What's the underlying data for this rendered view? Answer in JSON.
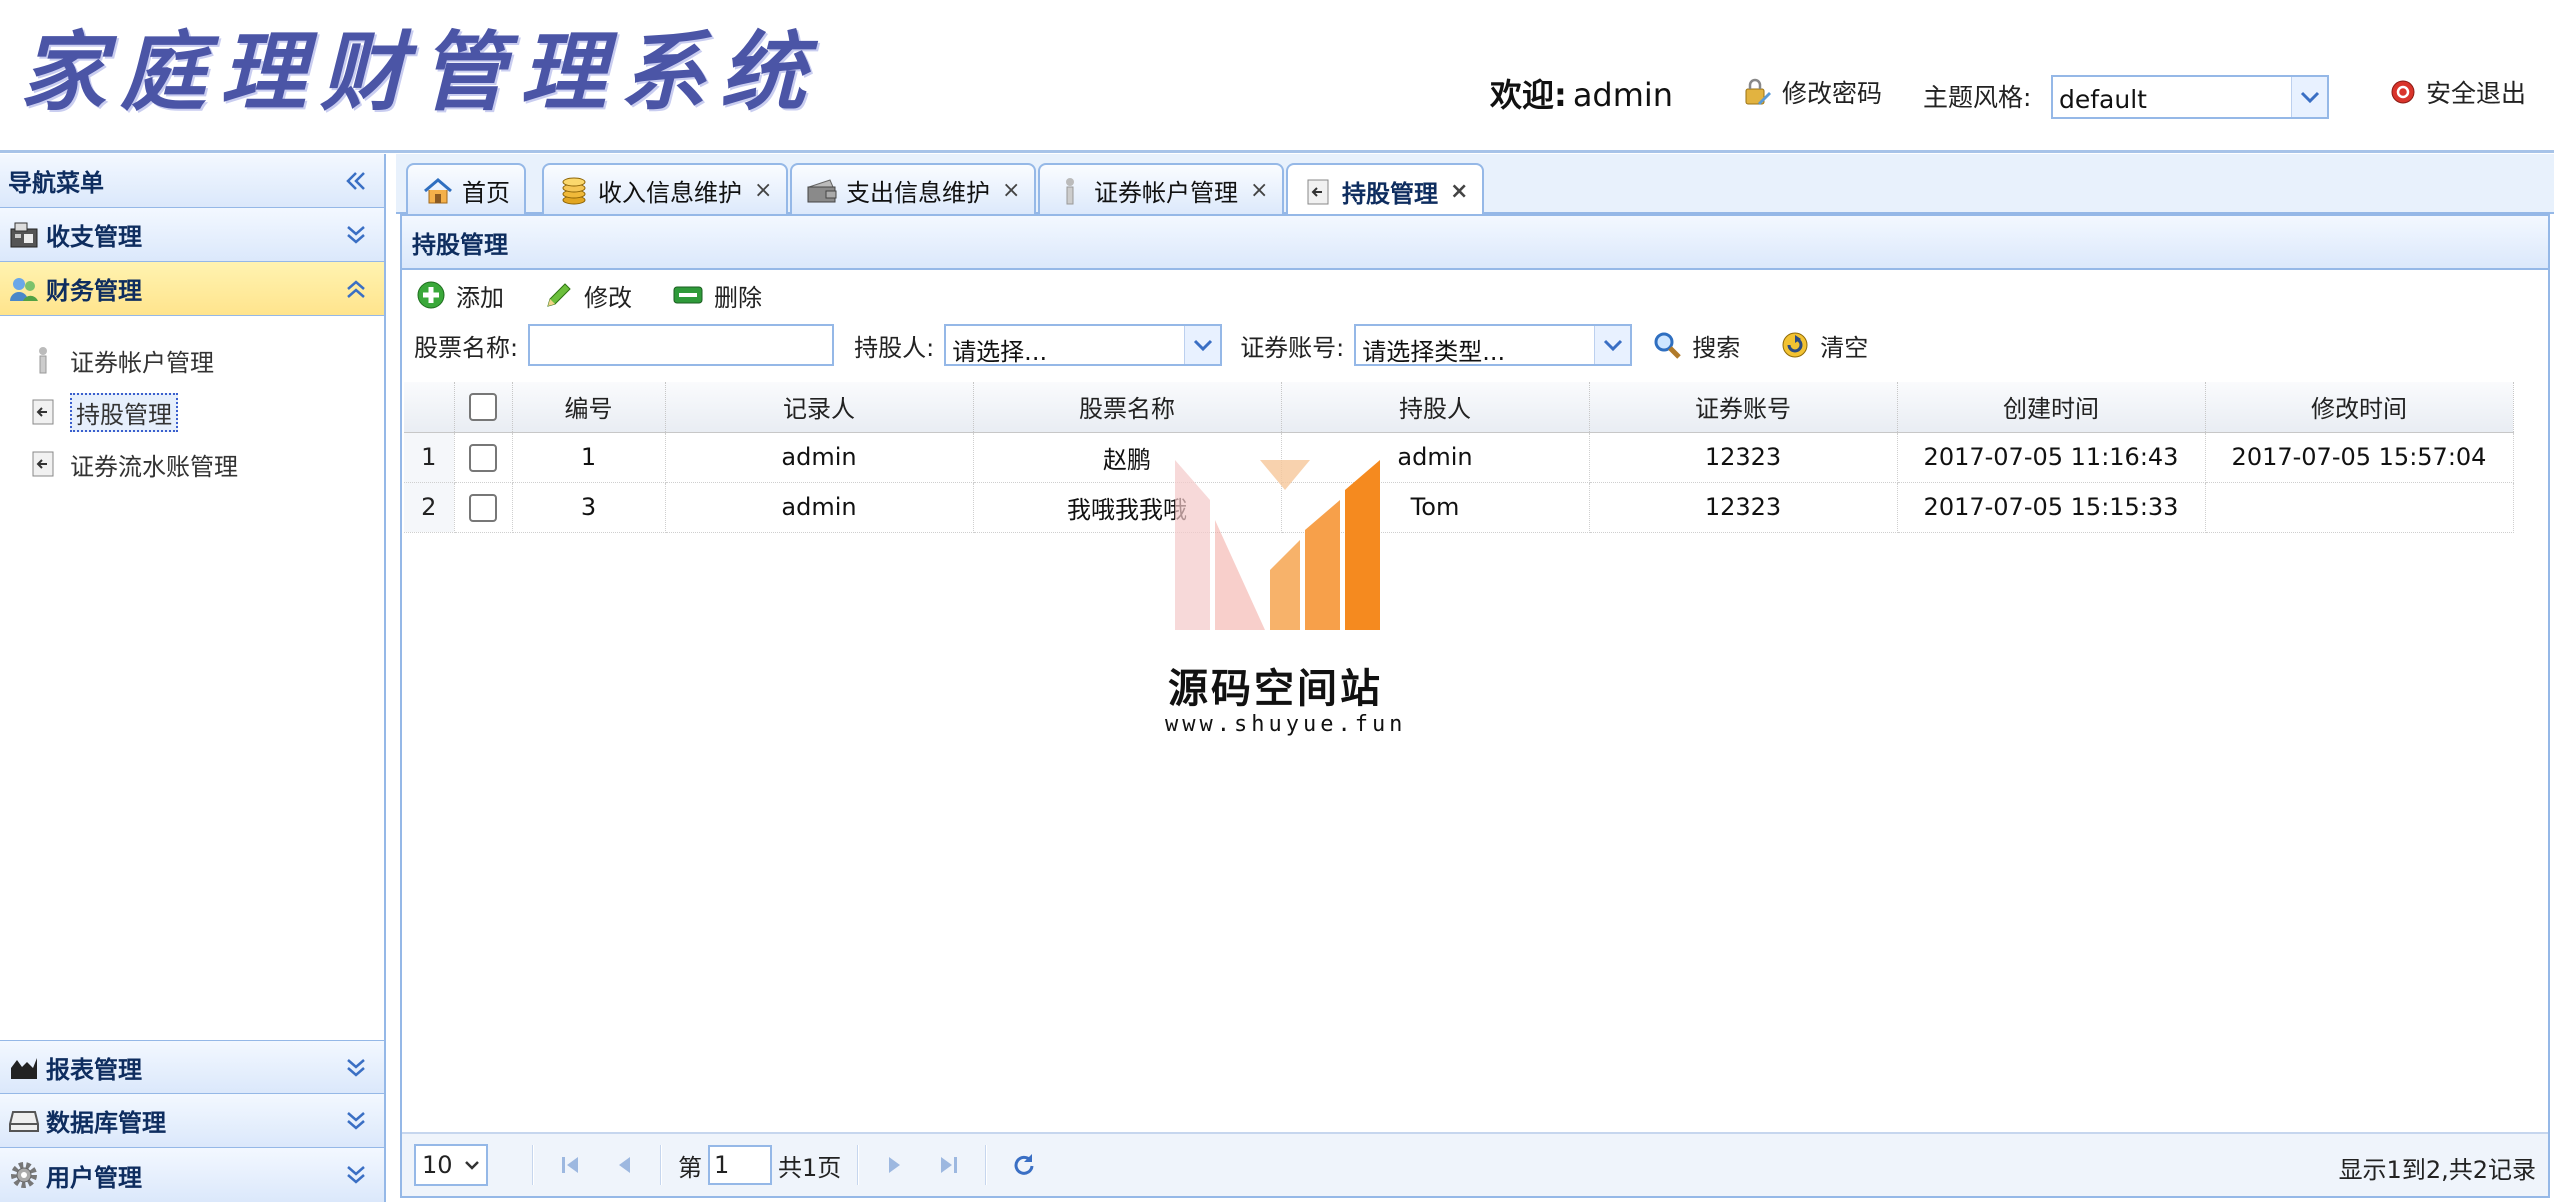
{
  "header": {
    "title": "家庭理财管理系统",
    "welcome_label": "欢迎:",
    "username": "admin",
    "change_password": "修改密码",
    "theme_label": "主题风格:",
    "theme_value": "default",
    "logout": "安全退出"
  },
  "sidebar": {
    "title": "导航菜单",
    "groups": {
      "income": "收支管理",
      "finance": "财务管理",
      "reports": "报表管理",
      "database": "数据库管理",
      "users": "用户管理"
    },
    "items": [
      "证券帐户管理",
      "持股管理",
      "证券流水账管理"
    ]
  },
  "tabs": [
    {
      "label": "首页"
    },
    {
      "label": "收入信息维护"
    },
    {
      "label": "支出信息维护"
    },
    {
      "label": "证券帐户管理"
    },
    {
      "label": "持股管理"
    }
  ],
  "content": {
    "title": "持股管理",
    "toolbar": {
      "add": "添加",
      "edit": "修改",
      "delete": "删除"
    },
    "filters": {
      "stock_name_label": "股票名称:",
      "stock_name_value": "",
      "holder_label": "持股人:",
      "holder_value": "请选择...",
      "account_label": "证券账号:",
      "account_value": "请选择类型...",
      "search": "搜索",
      "clear": "清空"
    },
    "columns": [
      "编号",
      "记录人",
      "股票名称",
      "持股人",
      "证券账号",
      "创建时间",
      "修改时间"
    ],
    "rows": [
      {
        "rn": "1",
        "id": "1",
        "recorder": "admin",
        "stock": "赵鹏",
        "holder": "admin",
        "account": "12323",
        "created": "2017-07-05 11:16:43",
        "modified": "2017-07-05 15:57:04"
      },
      {
        "rn": "2",
        "id": "3",
        "recorder": "admin",
        "stock": "我哦我我哦",
        "holder": "Tom",
        "account": "12323",
        "created": "2017-07-05 15:15:33",
        "modified": ""
      }
    ]
  },
  "pager": {
    "page_size": "10",
    "page_prefix": "第",
    "page_value": "1",
    "page_suffix": "共1页",
    "info": "显示1到2,共2记录"
  },
  "watermark": {
    "title": "源码空间站",
    "url": "www.shuyue.fun"
  }
}
